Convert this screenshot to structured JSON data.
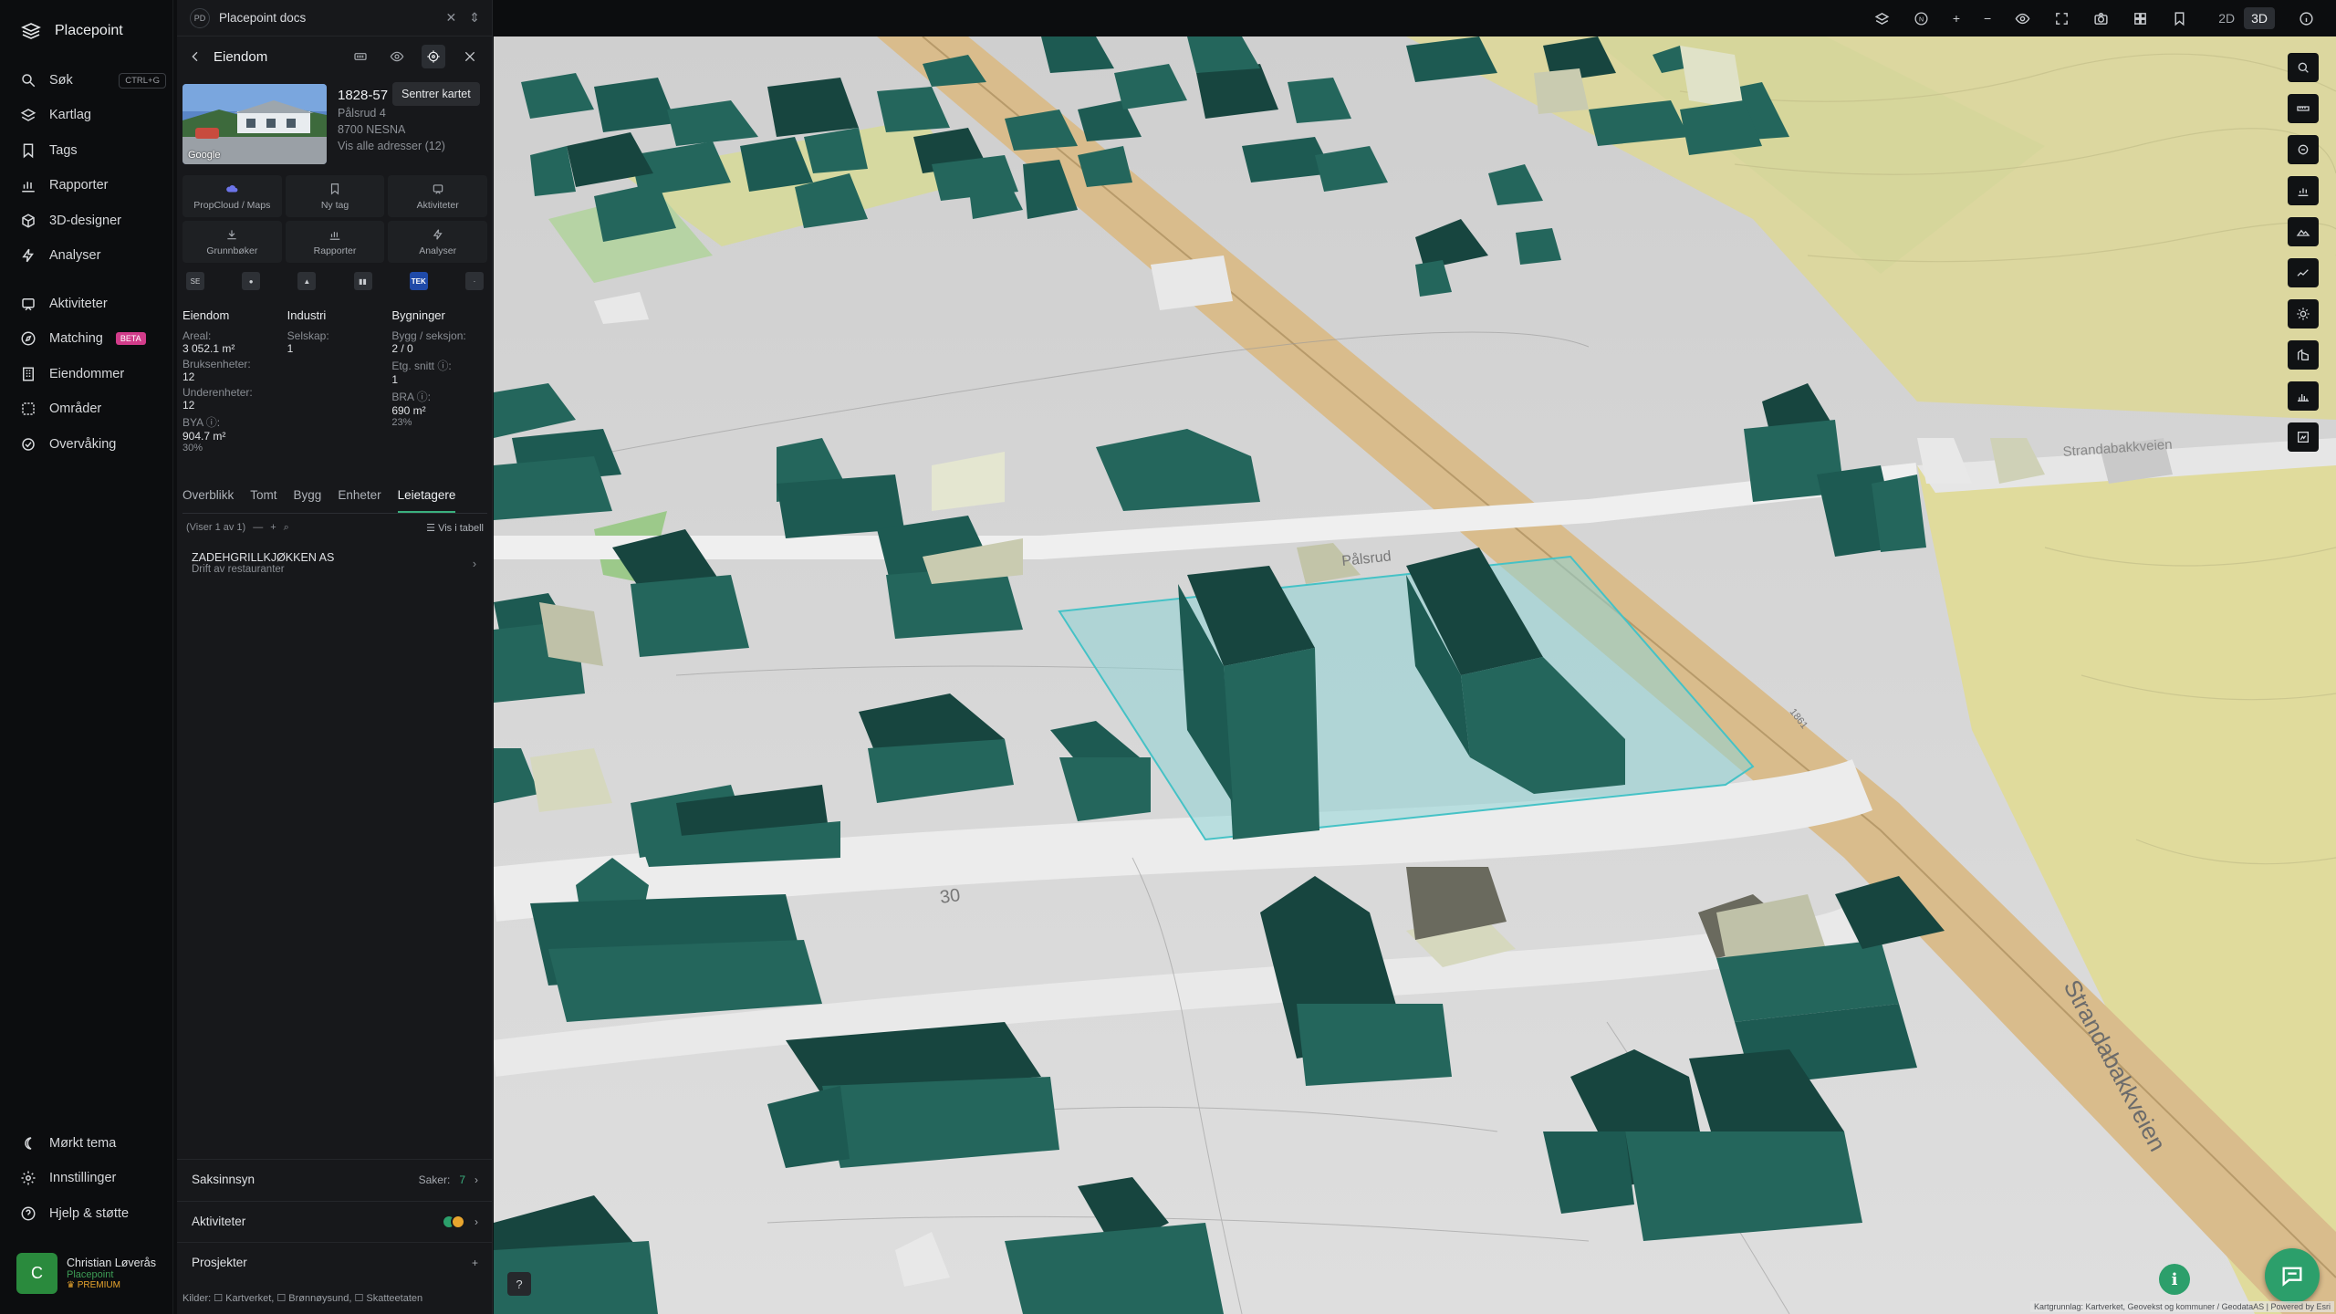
{
  "app": {
    "name": "Placepoint"
  },
  "nav": {
    "items": [
      {
        "label": "Søk",
        "icon": "search-icon",
        "shortcut": "CTRL+G"
      },
      {
        "label": "Kartlag",
        "icon": "layers-icon"
      },
      {
        "label": "Tags",
        "icon": "bookmark-icon"
      },
      {
        "label": "Rapporter",
        "icon": "chart-icon"
      },
      {
        "label": "3D-designer",
        "icon": "cube-icon"
      },
      {
        "label": "Analyser",
        "icon": "bolt-icon"
      },
      {
        "label": "Aktiviteter",
        "icon": "activity-icon"
      },
      {
        "label": "Matching",
        "icon": "compass-icon",
        "badge": "BETA"
      },
      {
        "label": "Eiendommer",
        "icon": "building-icon"
      },
      {
        "label": "Områder",
        "icon": "area-icon"
      },
      {
        "label": "Overvåking",
        "icon": "watch-icon"
      }
    ],
    "bottom": [
      {
        "label": "Mørkt tema",
        "icon": "moon-icon"
      },
      {
        "label": "Innstillinger",
        "icon": "gear-icon"
      },
      {
        "label": "Hjelp & støtte",
        "icon": "help-icon"
      }
    ],
    "user": {
      "initial": "C",
      "name": "Christian Løverås",
      "org": "Placepoint",
      "tier": "PREMIUM"
    }
  },
  "workspace": {
    "badge": "PD",
    "title": "Placepoint docs"
  },
  "panel": {
    "title": "Eiendom",
    "tooltip": "Sentrer kartet",
    "photo_credit": "Google",
    "address": {
      "id": "1828-57",
      "street": "Pålsrud 4",
      "postal": "8700 NESNA",
      "all_link": "Vis alle adresser (12)"
    },
    "tiles": [
      {
        "label": "PropCloud / Maps",
        "icon": "cloud-icon"
      },
      {
        "label": "Ny tag",
        "icon": "bookmark-icon"
      },
      {
        "label": "Aktiviteter",
        "icon": "activity-icon"
      },
      {
        "label": "Grunnbøker",
        "icon": "download-icon"
      },
      {
        "label": "Rapporter",
        "icon": "chart-icon"
      },
      {
        "label": "Analyser",
        "icon": "bolt-icon"
      }
    ],
    "registers": [
      "SE",
      "●",
      "▲",
      "▮▮",
      "TEK",
      "·"
    ],
    "facts": [
      {
        "heading": "Eiendom",
        "rows": [
          {
            "label": "Areal:",
            "value": "3 052.1 m²"
          },
          {
            "label": "Bruksenheter:",
            "value": "12"
          },
          {
            "label": "Underenheter:",
            "value": "12"
          },
          {
            "label": "BYA ⓘ:",
            "value": "904.7 m²",
            "pct": "30%"
          }
        ]
      },
      {
        "heading": "Industri",
        "rows": [
          {
            "label": "Selskap:",
            "value": "1"
          }
        ]
      },
      {
        "heading": "Bygninger",
        "rows": [
          {
            "label": "Bygg / seksjon:",
            "value": "2 / 0"
          },
          {
            "label": "Etg. snitt ⓘ:",
            "value": "1"
          },
          {
            "label": "BRA ⓘ:",
            "value": "690 m²",
            "pct": "23%"
          }
        ]
      }
    ],
    "tabs": [
      "Overblikk",
      "Tomt",
      "Bygg",
      "Enheter",
      "Leietagere"
    ],
    "active_tab": "Leietagere",
    "tenant_bar": {
      "count_text": "(Viser 1 av 1)",
      "table_link": "Vis i tabell"
    },
    "tenants": [
      {
        "name": "ZADEHGRILLKJØKKEN AS",
        "desc": "Drift av restauranter"
      }
    ],
    "sections": [
      {
        "label": "Saksinnsyn",
        "meta_label": "Saker:",
        "meta_value": "7"
      },
      {
        "label": "Aktiviteter"
      },
      {
        "label": "Prosjekter"
      }
    ],
    "sources": "Kilder: ☐ Kartverket, ☐ Brønnøysund, ☐ Skatteetaten"
  },
  "map": {
    "view_modes": [
      "2D",
      "3D"
    ],
    "active_view": "3D",
    "compass": "N",
    "road_labels": [
      "Pålsrud",
      "Strandabakkveien",
      "Strandabakkveien"
    ],
    "contour_label": "30",
    "road_number": "1861",
    "attribution": "Kartgrunnlag: Kartverket, Geovekst og kommuner / GeodataAS | Powered by Esri",
    "colors": {
      "building": "#24665c",
      "building_dark": "#17453f",
      "parcel": "#8fd3d6",
      "fields": "#ddd8a0",
      "road": "#d9bc8c",
      "ground": "#dcdcdc"
    }
  }
}
